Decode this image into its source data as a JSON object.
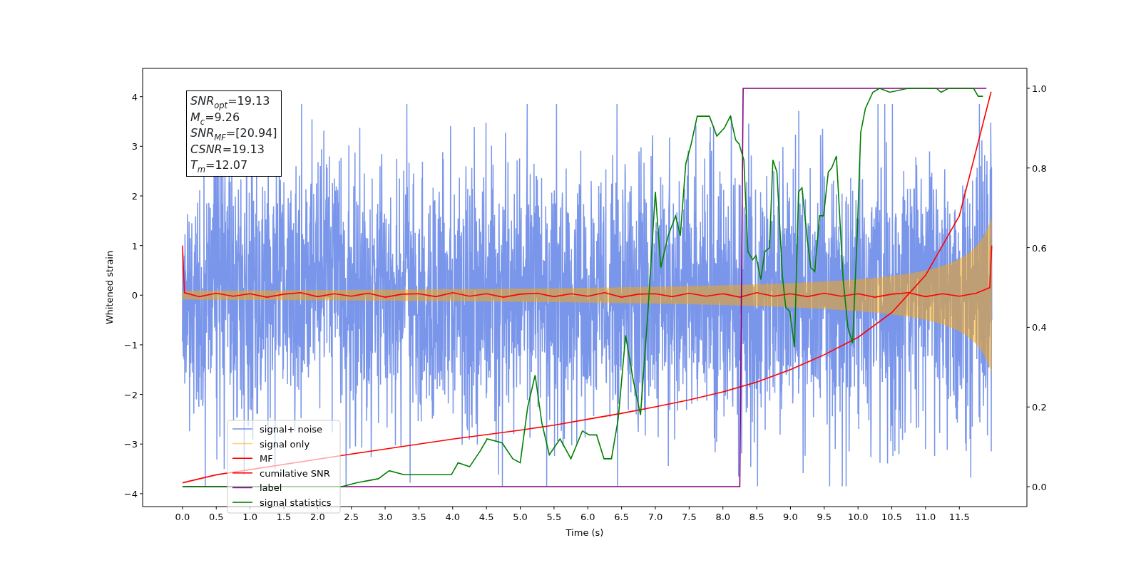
{
  "figure": {
    "chart_data": {
      "type": "line",
      "xlabel": "Time (s)",
      "ylabel": "Whitened strain",
      "xlim": [
        -0.59,
        12.5
      ],
      "ylim": [
        -4.26,
        4.57
      ],
      "y2lim": [
        -0.05,
        1.05
      ],
      "xticks": [
        {
          "value": 0,
          "label": "0.0"
        },
        {
          "value": 0.5,
          "label": "0.5"
        },
        {
          "value": 1,
          "label": "1.0"
        },
        {
          "value": 1.5,
          "label": "1.5"
        },
        {
          "value": 2,
          "label": "2.0"
        },
        {
          "value": 2.5,
          "label": "2.5"
        },
        {
          "value": 3,
          "label": "3.0"
        },
        {
          "value": 3.5,
          "label": "3.5"
        },
        {
          "value": 4,
          "label": "4.0"
        },
        {
          "value": 4.5,
          "label": "4.5"
        },
        {
          "value": 5,
          "label": "5.0"
        },
        {
          "value": 5.5,
          "label": "5.5"
        },
        {
          "value": 6,
          "label": "6.0"
        },
        {
          "value": 6.5,
          "label": "6.5"
        },
        {
          "value": 7,
          "label": "7.0"
        },
        {
          "value": 7.5,
          "label": "7.5"
        },
        {
          "value": 8,
          "label": "8.0"
        },
        {
          "value": 8.5,
          "label": "8.5"
        },
        {
          "value": 9,
          "label": "9.0"
        },
        {
          "value": 9.5,
          "label": "9.5"
        },
        {
          "value": 10,
          "label": "10.0"
        },
        {
          "value": 10.5,
          "label": "10.5"
        },
        {
          "value": 11,
          "label": "11.0"
        },
        {
          "value": 11.5,
          "label": "11.5"
        }
      ],
      "yticks": [
        {
          "value": -4,
          "label": "−4"
        },
        {
          "value": -3,
          "label": "−3"
        },
        {
          "value": -2,
          "label": "−2"
        },
        {
          "value": -1,
          "label": "−1"
        },
        {
          "value": 0,
          "label": "0"
        },
        {
          "value": 1,
          "label": "1"
        },
        {
          "value": 2,
          "label": "2"
        },
        {
          "value": 3,
          "label": "3"
        },
        {
          "value": 4,
          "label": "4"
        }
      ],
      "y2ticks": [
        {
          "value": 0,
          "label": "0.0"
        },
        {
          "value": 0.2,
          "label": "0.2"
        },
        {
          "value": 0.4,
          "label": "0.4"
        },
        {
          "value": 0.6,
          "label": "0.6"
        },
        {
          "value": 0.8,
          "label": "0.8"
        },
        {
          "value": 1,
          "label": "1.0"
        }
      ],
      "series": [
        {
          "name": "signal+ noise",
          "color": "#4169e1"
        },
        {
          "name": "signal only",
          "color": "#ffa500"
        },
        {
          "name": "MF",
          "color": "#ff0000",
          "x": [
            0,
            0.03,
            0.25,
            0.5,
            0.75,
            1,
            1.25,
            1.5,
            1.75,
            2,
            2.25,
            2.5,
            2.75,
            3,
            3.25,
            3.5,
            3.75,
            4,
            4.25,
            4.5,
            4.75,
            5,
            5.25,
            5.5,
            5.75,
            6,
            6.25,
            6.5,
            6.75,
            7,
            7.25,
            7.5,
            7.75,
            8,
            8.25,
            8.5,
            8.75,
            9,
            9.25,
            9.5,
            9.75,
            10,
            10.25,
            10.5,
            10.75,
            11,
            11.25,
            11.5,
            11.75,
            11.95,
            11.98
          ],
          "values": [
            1,
            0.05,
            -0.03,
            0.04,
            -0.02,
            0.03,
            -0.04,
            0.02,
            0.05,
            -0.03,
            0.03,
            -0.02,
            0.04,
            -0.04,
            0.02,
            0.03,
            -0.03,
            0.05,
            -0.02,
            0.03,
            -0.04,
            0.02,
            0.04,
            -0.03,
            0.03,
            -0.02,
            0.05,
            -0.04,
            0.02,
            0.03,
            -0.03,
            0.04,
            -0.02,
            0.03,
            -0.04,
            0.05,
            -0.02,
            0.03,
            -0.03,
            0.04,
            -0.02,
            0.03,
            -0.04,
            0.02,
            0.05,
            -0.03,
            0.03,
            -0.02,
            0.04,
            0.15,
            1
          ]
        },
        {
          "name": "cumilative SNR",
          "color": "#ff0000",
          "x": [
            0,
            0.5,
            2.5,
            3,
            3.5,
            4,
            4.5,
            5,
            5.5,
            6,
            6.5,
            7,
            7.5,
            8,
            8.5,
            9,
            9.5,
            10,
            10.5,
            11,
            11.5,
            11.97
          ],
          "values": [
            -3.78,
            -3.62,
            -3.2,
            -3.1,
            -3.0,
            -2.9,
            -2.81,
            -2.72,
            -2.62,
            -2.5,
            -2.38,
            -2.25,
            -2.11,
            -1.95,
            -1.75,
            -1.5,
            -1.2,
            -0.85,
            -0.35,
            0.4,
            1.6,
            4.1
          ]
        },
        {
          "name": "label",
          "color": "#800080",
          "axis": "y2",
          "x": [
            0,
            8.25,
            8.3,
            11.9
          ],
          "values": [
            0,
            0,
            1,
            1
          ]
        },
        {
          "name": "signal statistics",
          "color": "#008000",
          "axis": "y2",
          "x": [
            0,
            0.53,
            2.36,
            2.58,
            2.9,
            3.06,
            3.28,
            3.55,
            3.76,
            3.98,
            4.08,
            4.25,
            4.41,
            4.51,
            4.73,
            4.89,
            5,
            5.11,
            5.22,
            5.32,
            5.43,
            5.59,
            5.75,
            5.92,
            6.02,
            6.13,
            6.24,
            6.35,
            6.45,
            6.56,
            6.67,
            6.78,
            6.89,
            7,
            7.08,
            7.19,
            7.3,
            7.37,
            7.45,
            7.53,
            7.62,
            7.69,
            7.8,
            7.91,
            8.02,
            8.11,
            8.19,
            8.24,
            8.31,
            8.37,
            8.44,
            8.49,
            8.56,
            8.62,
            8.69,
            8.74,
            8.8,
            8.88,
            8.93,
            8.99,
            9.06,
            9.12,
            9.17,
            9.25,
            9.3,
            9.36,
            9.43,
            9.49,
            9.56,
            9.61,
            9.68,
            9.78,
            9.85,
            9.92,
            9.99,
            10.04,
            10.11,
            10.22,
            10.32,
            10.47,
            10.74,
            11.16,
            11.23,
            11.34,
            11.63,
            11.71,
            11.78,
            11.85
          ],
          "values": [
            0,
            0,
            0,
            0.01,
            0.02,
            0.04,
            0.03,
            0.03,
            0.03,
            0.03,
            0.06,
            0.05,
            0.09,
            0.12,
            0.11,
            0.07,
            0.06,
            0.2,
            0.28,
            0.16,
            0.08,
            0.12,
            0.07,
            0.14,
            0.13,
            0.13,
            0.07,
            0.07,
            0.17,
            0.38,
            0.27,
            0.18,
            0.44,
            0.74,
            0.55,
            0.63,
            0.68,
            0.63,
            0.81,
            0.86,
            0.93,
            0.93,
            0.93,
            0.88,
            0.9,
            0.93,
            0.87,
            0.86,
            0.82,
            0.59,
            0.57,
            0.58,
            0.52,
            0.59,
            0.6,
            0.82,
            0.79,
            0.53,
            0.45,
            0.44,
            0.35,
            0.74,
            0.75,
            0.62,
            0.55,
            0.54,
            0.68,
            0.68,
            0.79,
            0.8,
            0.83,
            0.52,
            0.4,
            0.36,
            0.64,
            0.89,
            0.95,
            0.99,
            1,
            0.99,
            1,
            1,
            0.99,
            1,
            1,
            1,
            0.98,
            0.98
          ]
        }
      ],
      "legend": true,
      "annotations": [
        {
          "text": "*SNR*$_{opt}$=19.13"
        },
        {
          "text": "*M*$_{c}$=9.26"
        },
        {
          "text": "*SNR*$_{MF}$=[20.94]"
        },
        {
          "text": "*CSNR*=19.13"
        },
        {
          "text": "*T*$_{m}$=12.07"
        }
      ]
    }
  }
}
